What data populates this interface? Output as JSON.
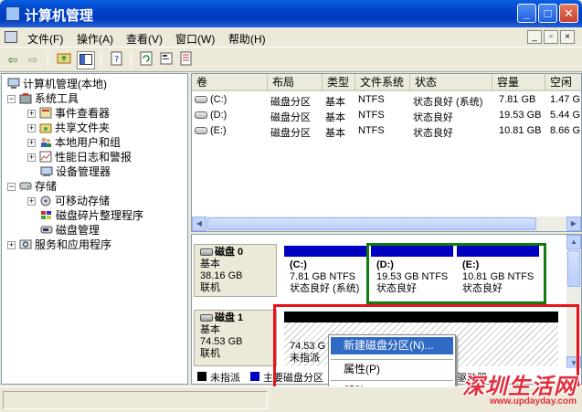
{
  "window": {
    "title": "计算机管理",
    "buttons": {
      "minimize": "_",
      "maximize": "□",
      "close": "✕"
    }
  },
  "menubar": {
    "items": [
      {
        "label": "文件(F)"
      },
      {
        "label": "操作(A)"
      },
      {
        "label": "查看(V)"
      },
      {
        "label": "窗口(W)"
      },
      {
        "label": "帮助(H)"
      }
    ],
    "mdi_buttons": [
      "_",
      "▫",
      "×"
    ]
  },
  "toolbar": {
    "back": "⇦",
    "forward": "⇨"
  },
  "tree": {
    "items": [
      {
        "label": "计算机管理(本地)",
        "icon": "computer-icon",
        "expander": ""
      },
      {
        "label": "系统工具",
        "icon": "tools-icon",
        "expander": "−"
      },
      {
        "label": "事件查看器",
        "icon": "event-viewer-icon",
        "expander": "+"
      },
      {
        "label": "共享文件夹",
        "icon": "shared-folder-icon",
        "expander": "+"
      },
      {
        "label": "本地用户和组",
        "icon": "users-icon",
        "expander": "+"
      },
      {
        "label": "性能日志和警报",
        "icon": "performance-icon",
        "expander": "+"
      },
      {
        "label": "设备管理器",
        "icon": "device-manager-icon",
        "expander": ""
      },
      {
        "label": "存储",
        "icon": "storage-icon",
        "expander": "−"
      },
      {
        "label": "可移动存储",
        "icon": "removable-storage-icon",
        "expander": "+"
      },
      {
        "label": "磁盘碎片整理程序",
        "icon": "defrag-icon",
        "expander": ""
      },
      {
        "label": "磁盘管理",
        "icon": "disk-management-icon",
        "expander": ""
      },
      {
        "label": "服务和应用程序",
        "icon": "services-icon",
        "expander": "+"
      }
    ]
  },
  "volume_list": {
    "columns": [
      "卷",
      "布局",
      "类型",
      "文件系统",
      "状态",
      "容量",
      "空闲"
    ],
    "rows": [
      {
        "volume": "(C:)",
        "layout": "磁盘分区",
        "type": "基本",
        "fs": "NTFS",
        "status": "状态良好 (系统)",
        "capacity": "7.81 GB",
        "free": "1.47 G"
      },
      {
        "volume": "(D:)",
        "layout": "磁盘分区",
        "type": "基本",
        "fs": "NTFS",
        "status": "状态良好",
        "capacity": "19.53 GB",
        "free": "5.44 G"
      },
      {
        "volume": "(E:)",
        "layout": "磁盘分区",
        "type": "基本",
        "fs": "NTFS",
        "status": "状态良好",
        "capacity": "10.81 GB",
        "free": "8.66 G"
      }
    ]
  },
  "disks": [
    {
      "name": "磁盘 0",
      "type": "基本",
      "size": "38.16 GB",
      "status": "联机",
      "partitions": [
        {
          "label": "(C:)",
          "size": "7.81 GB NTFS",
          "status": "状态良好 (系统)"
        },
        {
          "label": "(D:)",
          "size": "19.53 GB NTFS",
          "status": "状态良好"
        },
        {
          "label": "(E:)",
          "size": "10.81 GB NTFS",
          "status": "状态良好"
        }
      ]
    },
    {
      "name": "磁盘 1",
      "type": "基本",
      "size": "74.53 GB",
      "status": "联机",
      "unallocated": {
        "size": "74.53 G",
        "status": "未指派"
      }
    }
  ],
  "legend": {
    "unallocated": "未指派",
    "primary": "主要磁盘分区",
    "trailing": "驱动器"
  },
  "context_menu": {
    "items": [
      "新建磁盘分区(N)...",
      "属性(P)",
      "帮助(H)"
    ]
  },
  "colors": {
    "primary_partition": "#0000c0",
    "unallocated": "#000000",
    "highlight_box": "#e8141c",
    "selected_partition_border": "#107c10",
    "menu_highlight": "#316ac5"
  },
  "watermark": {
    "main": "深圳生活网",
    "url": "www.updayday.com"
  }
}
